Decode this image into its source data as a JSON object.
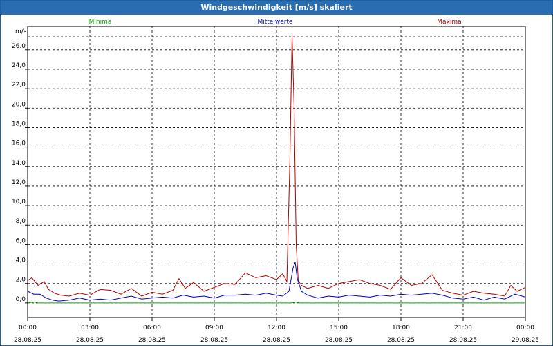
{
  "window_title": "Windgeschwindigkeit [m/s] skaliert",
  "chart_data": {
    "type": "line",
    "title": "Windgeschwindigkeit [m/s] skaliert",
    "ylabel": "m/s",
    "xlabel": "",
    "ylim": [
      -1.5,
      28.4
    ],
    "xlim": [
      0,
      24
    ],
    "y_ticks": [
      0,
      2,
      4,
      6,
      8,
      10,
      12,
      14,
      16,
      18,
      20,
      22,
      24,
      26
    ],
    "y_tick_labels": [
      "0,0",
      "2,0",
      "4,0",
      "6,0",
      "8,0",
      "10,0",
      "12,0",
      "14,0",
      "16,0",
      "18,0",
      "20,0",
      "22,0",
      "24,0",
      "26,0"
    ],
    "x_ticks": [
      {
        "x": 0,
        "time": "00:00",
        "date": "28.08.25"
      },
      {
        "x": 3,
        "time": "03:00",
        "date": "28.08.25"
      },
      {
        "x": 6,
        "time": "06:00",
        "date": "28.08.25"
      },
      {
        "x": 9,
        "time": "09:00",
        "date": "28.08.25"
      },
      {
        "x": 12,
        "time": "12:00",
        "date": "28.08.25"
      },
      {
        "x": 15,
        "time": "15:00",
        "date": "28.08.25"
      },
      {
        "x": 18,
        "time": "18:00",
        "date": "28.08.25"
      },
      {
        "x": 21,
        "time": "21:00",
        "date": "28.08.25"
      },
      {
        "x": 24,
        "time": "00:00",
        "date": "29.08.25"
      }
    ],
    "grid": true,
    "legend_position": "top",
    "series": [
      {
        "name": "Minima",
        "color": "#00b000",
        "x": [
          0,
          0.3,
          0.5,
          1,
          2,
          4,
          6,
          8,
          10,
          12,
          12.7,
          12.9,
          13.1,
          14,
          16,
          18,
          20,
          22,
          24
        ],
        "y": [
          0.0,
          0.1,
          0.0,
          0.0,
          0.0,
          0.0,
          0.0,
          0.0,
          0.0,
          0.0,
          0.0,
          0.1,
          0.0,
          0.0,
          0.0,
          0.0,
          0.0,
          0.0,
          0.0
        ]
      },
      {
        "name": "Mittelwerte",
        "color": "#0000c8",
        "x": [
          0,
          0.3,
          0.6,
          0.9,
          1.2,
          1.5,
          2,
          2.5,
          3,
          3.5,
          4,
          4.5,
          5,
          5.5,
          6,
          6.5,
          7,
          7.5,
          8,
          8.5,
          9,
          9.5,
          10,
          10.5,
          11,
          11.5,
          12,
          12.3,
          12.6,
          12.8,
          12.9,
          13.0,
          13.2,
          13.5,
          14,
          14.5,
          15,
          15.5,
          16,
          16.5,
          17,
          17.5,
          18,
          18.5,
          19,
          19.5,
          20,
          20.5,
          21,
          21.5,
          22,
          22.5,
          23,
          23.5,
          24
        ],
        "y": [
          1.2,
          0.9,
          0.9,
          0.5,
          0.3,
          0.2,
          0.3,
          0.5,
          0.3,
          0.4,
          0.3,
          0.5,
          0.7,
          0.4,
          0.5,
          0.6,
          0.5,
          0.8,
          0.6,
          0.7,
          0.5,
          0.8,
          0.8,
          0.9,
          0.8,
          1.0,
          0.8,
          0.7,
          1.2,
          3.6,
          4.2,
          2.5,
          1.2,
          0.8,
          0.5,
          0.7,
          0.6,
          0.8,
          0.7,
          0.6,
          0.8,
          0.7,
          0.9,
          0.8,
          0.9,
          1.0,
          0.8,
          0.5,
          0.4,
          0.6,
          0.3,
          0.6,
          0.4,
          0.9,
          0.6
        ]
      },
      {
        "name": "Maxima",
        "color": "#b00000",
        "x": [
          0,
          0.2,
          0.5,
          0.8,
          1.0,
          1.3,
          1.6,
          2.0,
          2.5,
          3.0,
          3.5,
          4.0,
          4.5,
          5.0,
          5.5,
          6.0,
          6.5,
          7.0,
          7.3,
          7.6,
          8.0,
          8.5,
          9.0,
          9.5,
          10.0,
          10.5,
          11.0,
          11.5,
          12.0,
          12.3,
          12.5,
          12.65,
          12.75,
          12.85,
          12.95,
          13.05,
          13.2,
          13.5,
          14.0,
          14.5,
          15.0,
          15.5,
          16.0,
          16.5,
          17.0,
          17.5,
          18.0,
          18.5,
          19.0,
          19.5,
          20.0,
          20.5,
          21.0,
          21.5,
          22.0,
          22.5,
          23.0,
          23.3,
          23.6,
          24.0
        ],
        "y": [
          2.3,
          2.6,
          1.8,
          2.2,
          1.4,
          1.0,
          0.8,
          0.7,
          1.0,
          0.8,
          1.4,
          1.3,
          0.9,
          1.5,
          0.7,
          1.1,
          0.9,
          1.3,
          2.5,
          1.5,
          2.1,
          1.2,
          1.6,
          2.0,
          1.9,
          3.1,
          2.6,
          2.8,
          2.4,
          3.0,
          2.2,
          15.0,
          27.5,
          20.0,
          6.0,
          2.3,
          1.8,
          1.5,
          1.8,
          1.5,
          2.0,
          2.2,
          2.4,
          2.0,
          1.8,
          1.4,
          2.6,
          1.8,
          2.0,
          2.9,
          1.3,
          1.0,
          0.8,
          1.2,
          1.0,
          0.9,
          0.7,
          1.8,
          1.2,
          1.6
        ]
      }
    ]
  }
}
